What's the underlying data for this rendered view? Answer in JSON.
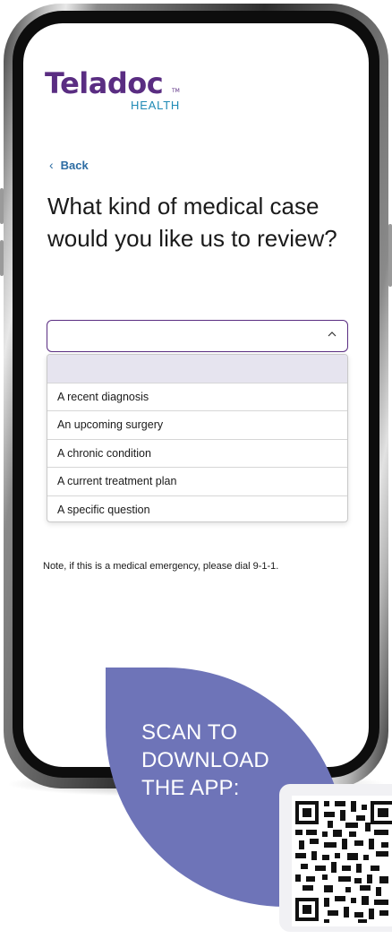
{
  "brand": {
    "name": "Teladoc",
    "tm": "TM",
    "subline": "HEALTH",
    "primary_color": "#5a2d82",
    "accent_color": "#1f8ab5"
  },
  "nav": {
    "back_label": "Back",
    "back_icon": "chevron-left-icon"
  },
  "question": "What kind of medical case would you like us to review?",
  "select": {
    "value": "",
    "icon": "chevron-up-icon",
    "options": [
      "",
      "A recent diagnosis",
      "An upcoming surgery",
      "A chronic condition",
      "A current treatment plan",
      "A specific question"
    ]
  },
  "note": "Note, if this is a medical emergency, please dial 9-1-1.",
  "promo": {
    "line1": "SCAN TO",
    "line2": "DOWNLOAD",
    "line3": "THE APP:",
    "blob_color": "#6e74b8",
    "qr_icon": "qr-code-icon"
  }
}
